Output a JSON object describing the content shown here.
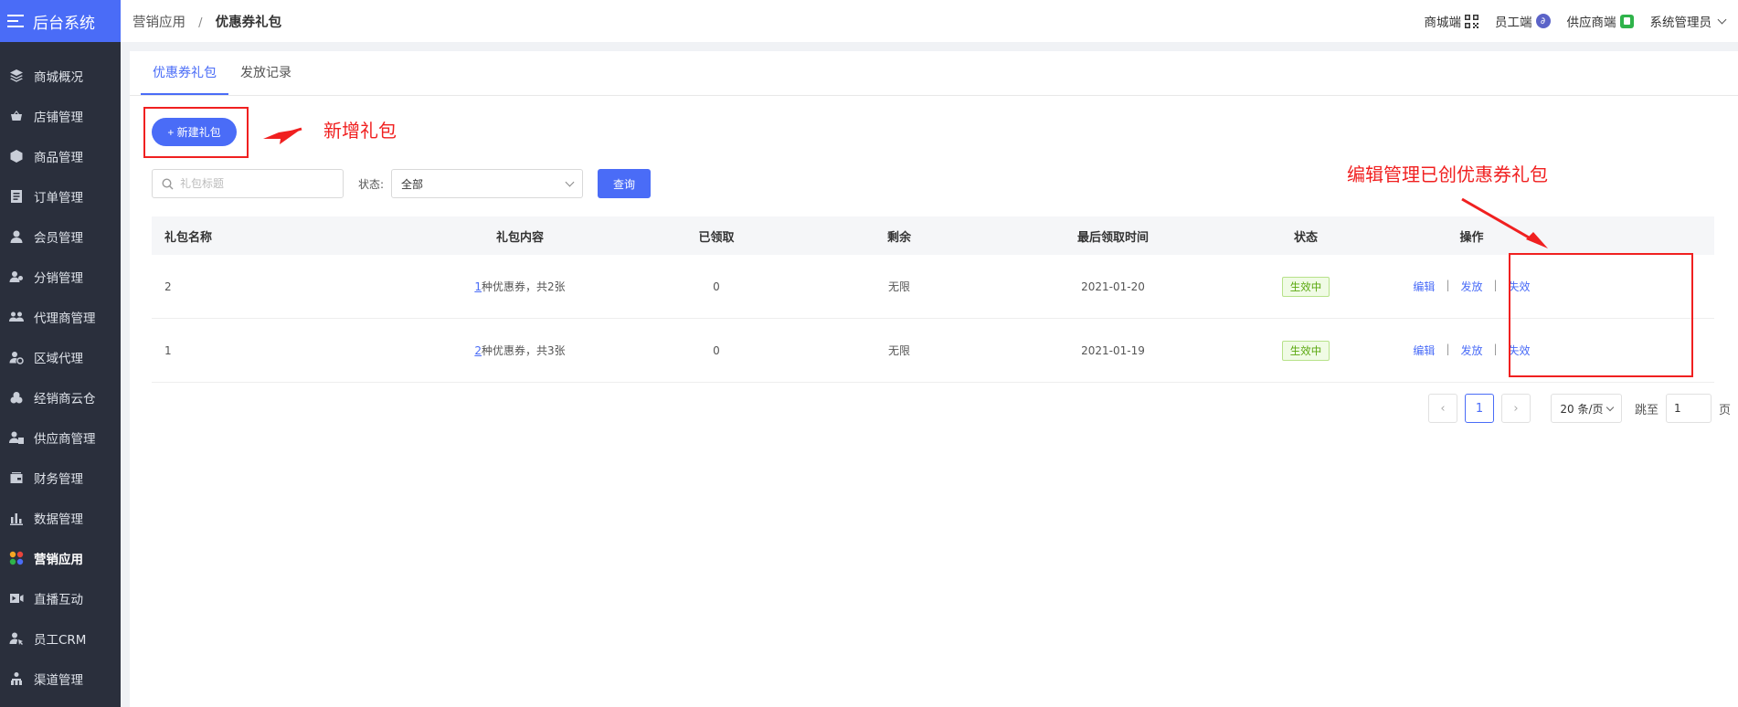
{
  "app": {
    "title": "后台系统"
  },
  "sidebar": {
    "items": [
      {
        "label": "商城概况",
        "icon": "layers-icon"
      },
      {
        "label": "店铺管理",
        "icon": "shop-basket-icon"
      },
      {
        "label": "商品管理",
        "icon": "cube-icon"
      },
      {
        "label": "订单管理",
        "icon": "order-list-icon"
      },
      {
        "label": "会员管理",
        "icon": "user-icon"
      },
      {
        "label": "分销管理",
        "icon": "distribution-icon"
      },
      {
        "label": "代理商管理",
        "icon": "agents-icon"
      },
      {
        "label": "区域代理",
        "icon": "region-user-icon"
      },
      {
        "label": "经销商云仓",
        "icon": "warehouse-icon"
      },
      {
        "label": "供应商管理",
        "icon": "supplier-icon"
      },
      {
        "label": "财务管理",
        "icon": "wallet-icon"
      },
      {
        "label": "数据管理",
        "icon": "bar-chart-icon"
      },
      {
        "label": "营销应用",
        "icon": "apps-icon",
        "active": true
      },
      {
        "label": "直播互动",
        "icon": "video-camera-icon"
      },
      {
        "label": "员工CRM",
        "icon": "staff-icon"
      },
      {
        "label": "渠道管理",
        "icon": "channel-icon"
      }
    ]
  },
  "header": {
    "breadcrumb": {
      "parent": "营销应用",
      "separator": "/",
      "current": "优惠券礼包"
    },
    "right": {
      "mall": "商城端",
      "staff": "员工端",
      "supplier": "供应商端",
      "admin": "系统管理员"
    }
  },
  "tabs": [
    {
      "label": "优惠券礼包",
      "active": true
    },
    {
      "label": "发放记录",
      "active": false
    }
  ],
  "toolbar": {
    "new_label": "+ 新建礼包"
  },
  "filter": {
    "search_placeholder": "礼包标题",
    "status_label": "状态:",
    "status_value": "全部",
    "query_label": "查询"
  },
  "table": {
    "headers": [
      "礼包名称",
      "礼包内容",
      "已领取",
      "剩余",
      "最后领取时间",
      "状态",
      "操作"
    ],
    "rows": [
      {
        "name": "2",
        "content_num": "1",
        "content_text": "种优惠券，共2张",
        "claimed": "0",
        "remaining": "无限",
        "last_time": "2021-01-20",
        "status": "生效中"
      },
      {
        "name": "1",
        "content_num": "2",
        "content_text": "种优惠券，共3张",
        "claimed": "0",
        "remaining": "无限",
        "last_time": "2021-01-19",
        "status": "生效中"
      }
    ],
    "ops": {
      "edit": "编辑",
      "issue": "发放",
      "invalidate": "失效",
      "sep": "|"
    }
  },
  "pagination": {
    "prev": "‹",
    "current_page": "1",
    "next": "›",
    "page_size": "20 条/页",
    "jump_label": "跳至",
    "jump_value": "1",
    "page_suffix": "页"
  },
  "annotations": {
    "new_package": "新增礼包",
    "edit_manage": "编辑管理已创优惠券礼包",
    "color": "#f02020"
  },
  "colors": {
    "primary": "#4a6cf7",
    "sidebar_bg": "#2a2f3c",
    "success": "#5aa80f"
  }
}
